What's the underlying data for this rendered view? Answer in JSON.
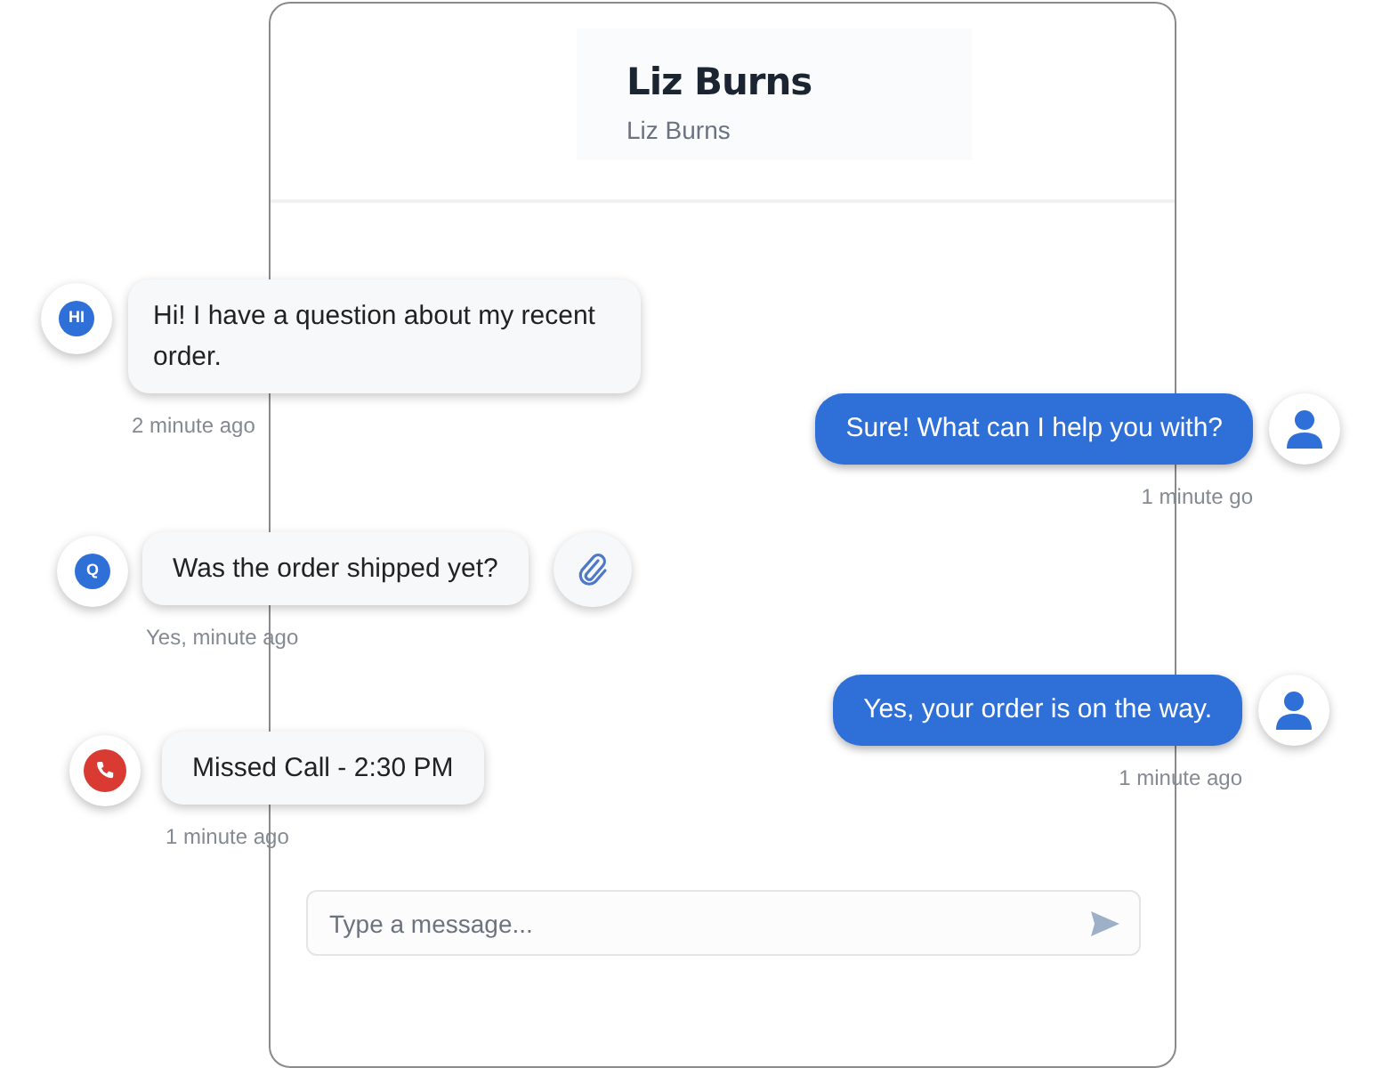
{
  "header": {
    "title": "Liz Burns",
    "subtitle": "Liz Burns"
  },
  "messages": [
    {
      "kind": "incoming",
      "text": "Hi! I have a question about my recent order.",
      "time": "2 minute ago",
      "avatar": {
        "kind": "initials",
        "label": "HI"
      },
      "attachment": false
    },
    {
      "kind": "outgoing",
      "text": "Sure! What can I help you with?",
      "time": "1 minute go",
      "avatar": {
        "kind": "person"
      },
      "attachment": false
    },
    {
      "kind": "incoming",
      "text": "Was the order shipped yet?",
      "time": "Yes, minute ago",
      "avatar": {
        "kind": "initials",
        "label": "Q"
      },
      "attachment": true
    },
    {
      "kind": "outgoing",
      "text": "Yes, your order is on the way.",
      "time": "1 minute ago",
      "avatar": {
        "kind": "person"
      },
      "attachment": false
    },
    {
      "kind": "incoming",
      "text": "Missed Call - 2:30 PM",
      "time": "1 minute ago",
      "avatar": {
        "kind": "call"
      },
      "attachment": false
    }
  ],
  "composer": {
    "placeholder": "Type a message..."
  }
}
